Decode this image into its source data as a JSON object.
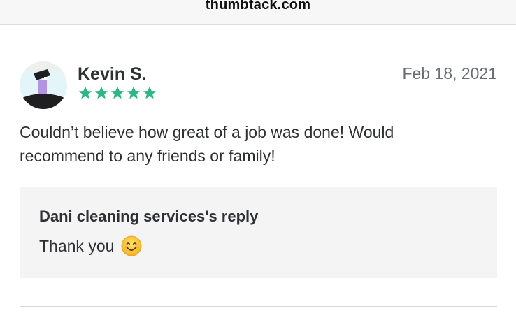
{
  "browser": {
    "url": "thumbtack.com"
  },
  "review": {
    "reviewer_name": "Kevin S.",
    "date": "Feb 18, 2021",
    "rating": 5,
    "rating_max": 5,
    "text": "Couldn’t believe how great of a job was done! Would recommend to any friends or family!",
    "star_color": "#2db783"
  },
  "reply": {
    "title": "Dani cleaning services's reply",
    "text": "Thank you",
    "emoji": "smiling-face-icon"
  }
}
